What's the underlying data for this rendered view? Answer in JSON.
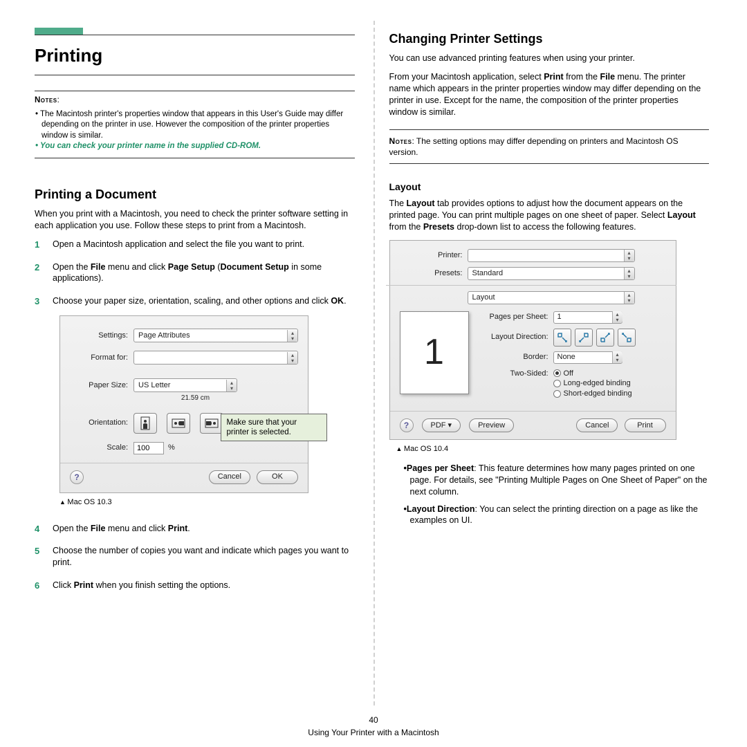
{
  "page": {
    "number": "40",
    "footer": "Using Your Printer with a Macintosh"
  },
  "left": {
    "title": "Printing",
    "notes_label": "Notes",
    "notes": [
      "The Macintosh printer's properties window that appears in this User's Guide may differ depending on the printer in use. However the composition of the printer properties window is similar.",
      "You can check your printer name in the supplied CD-ROM."
    ],
    "section_title": "Printing a Document",
    "section_intro": "When you print with a Macintosh, you need to check the printer software setting in each application you use. Follow these steps to print from a Macintosh.",
    "steps": {
      "s1": "Open a Macintosh application and select the file you want to print.",
      "s2_a": "Open the ",
      "s2_b": "File",
      "s2_c": " menu and click ",
      "s2_d": "Page Setup",
      "s2_e": " (",
      "s2_f": "Document Setup",
      "s2_g": " in some applications).",
      "s3_a": "Choose your paper size, orientation, scaling, and other options and click ",
      "s3_b": "OK",
      "s3_c": ".",
      "s4_a": "Open the ",
      "s4_b": "File",
      "s4_c": " menu and click ",
      "s4_d": "Print",
      "s4_e": ".",
      "s5": "Choose the number of copies you want and indicate which pages you want to print.",
      "s6_a": "Click ",
      "s6_b": "Print",
      "s6_c": " when you finish setting the options."
    },
    "dialog": {
      "settings_label": "Settings:",
      "settings_value": "Page Attributes",
      "format_label": "Format for:",
      "paper_label": "Paper Size:",
      "paper_value": "US Letter",
      "paper_sub": "21.59 cm",
      "orient_label": "Orientation:",
      "scale_label": "Scale:",
      "scale_value": "100",
      "scale_unit": "%",
      "cancel": "Cancel",
      "ok": "OK",
      "help": "?",
      "callout": "Make sure that your printer is selected."
    },
    "caption": "Mac OS 10.3"
  },
  "right": {
    "title": "Changing Printer Settings",
    "intro1": "You can use advanced printing features when using your printer.",
    "intro2_a": "From your Macintosh application, select ",
    "intro2_b": "Print",
    "intro2_c": " from the ",
    "intro2_d": "File",
    "intro2_e": " menu. The printer name which appears in the printer properties window may differ depending on the printer in use. Except for the name, the composition of the printer properties window is similar.",
    "notes_label": "Notes",
    "notes_text": ": The setting options may differ depending on printers and Macintosh OS version.",
    "layout_title": "Layout",
    "layout_intro_a": "The ",
    "layout_intro_b": "Layout",
    "layout_intro_c": " tab provides options to adjust how the document appears on the printed page. You can print multiple pages on one sheet of paper. Select ",
    "layout_intro_d": "Layout",
    "layout_intro_e": " from the ",
    "layout_intro_f": "Presets",
    "layout_intro_g": " drop-down list to access the following features.",
    "dialog": {
      "printer_label": "Printer:",
      "presets_label": "Presets:",
      "presets_value": "Standard",
      "panel_value": "Layout",
      "preview_number": "1",
      "pps_label": "Pages per Sheet:",
      "pps_value": "1",
      "dir_label": "Layout Direction:",
      "border_label": "Border:",
      "border_value": "None",
      "two_label": "Two-Sided:",
      "opt_off": "Off",
      "opt_long": "Long-edged binding",
      "opt_short": "Short-edged binding",
      "help": "?",
      "pdf": "PDF ▾",
      "preview": "Preview",
      "cancel": "Cancel",
      "print": "Print"
    },
    "caption": "Mac OS 10.4",
    "features": {
      "f1_a": "Pages per Sheet",
      "f1_b": ": This feature determines how many pages printed on one page. For details, see \"Printing Multiple Pages on One Sheet of Paper\" on the next column.",
      "f2_a": "Layout Direction",
      "f2_b": ": You can select the printing direction on a page as like the examples on UI."
    }
  }
}
